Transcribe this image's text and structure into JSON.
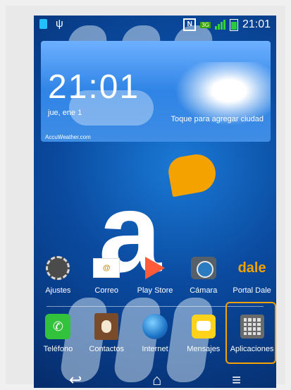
{
  "status_bar": {
    "time": "21:01",
    "network": "3G"
  },
  "weather_widget": {
    "time": "21:01",
    "date": "jue, ene 1",
    "city_prompt": "Toque para agregar ciudad",
    "provider": "AccuWeather.com"
  },
  "brand_logo": {
    "text": "a"
  },
  "home_apps": [
    {
      "label": "Ajustes",
      "icon": "gear-icon"
    },
    {
      "label": "Correo",
      "icon": "mail-icon"
    },
    {
      "label": "Play Store",
      "icon": "play-store-icon"
    },
    {
      "label": "Cámara",
      "icon": "camera-icon"
    },
    {
      "label": "Portal Dale",
      "icon": "dale-icon",
      "icon_text": "dale"
    }
  ],
  "dock_apps": [
    {
      "label": "Teléfono",
      "icon": "phone-icon"
    },
    {
      "label": "Contactos",
      "icon": "contacts-icon"
    },
    {
      "label": "Internet",
      "icon": "globe-icon"
    },
    {
      "label": "Mensajes",
      "icon": "messages-icon"
    },
    {
      "label": "Aplicaciones",
      "icon": "apps-grid-icon"
    }
  ],
  "navigation": {
    "back": "↩",
    "home": "⌂",
    "menu": "≡"
  },
  "colors": {
    "accent": "#f3a200",
    "background": "#0a4a9f"
  }
}
